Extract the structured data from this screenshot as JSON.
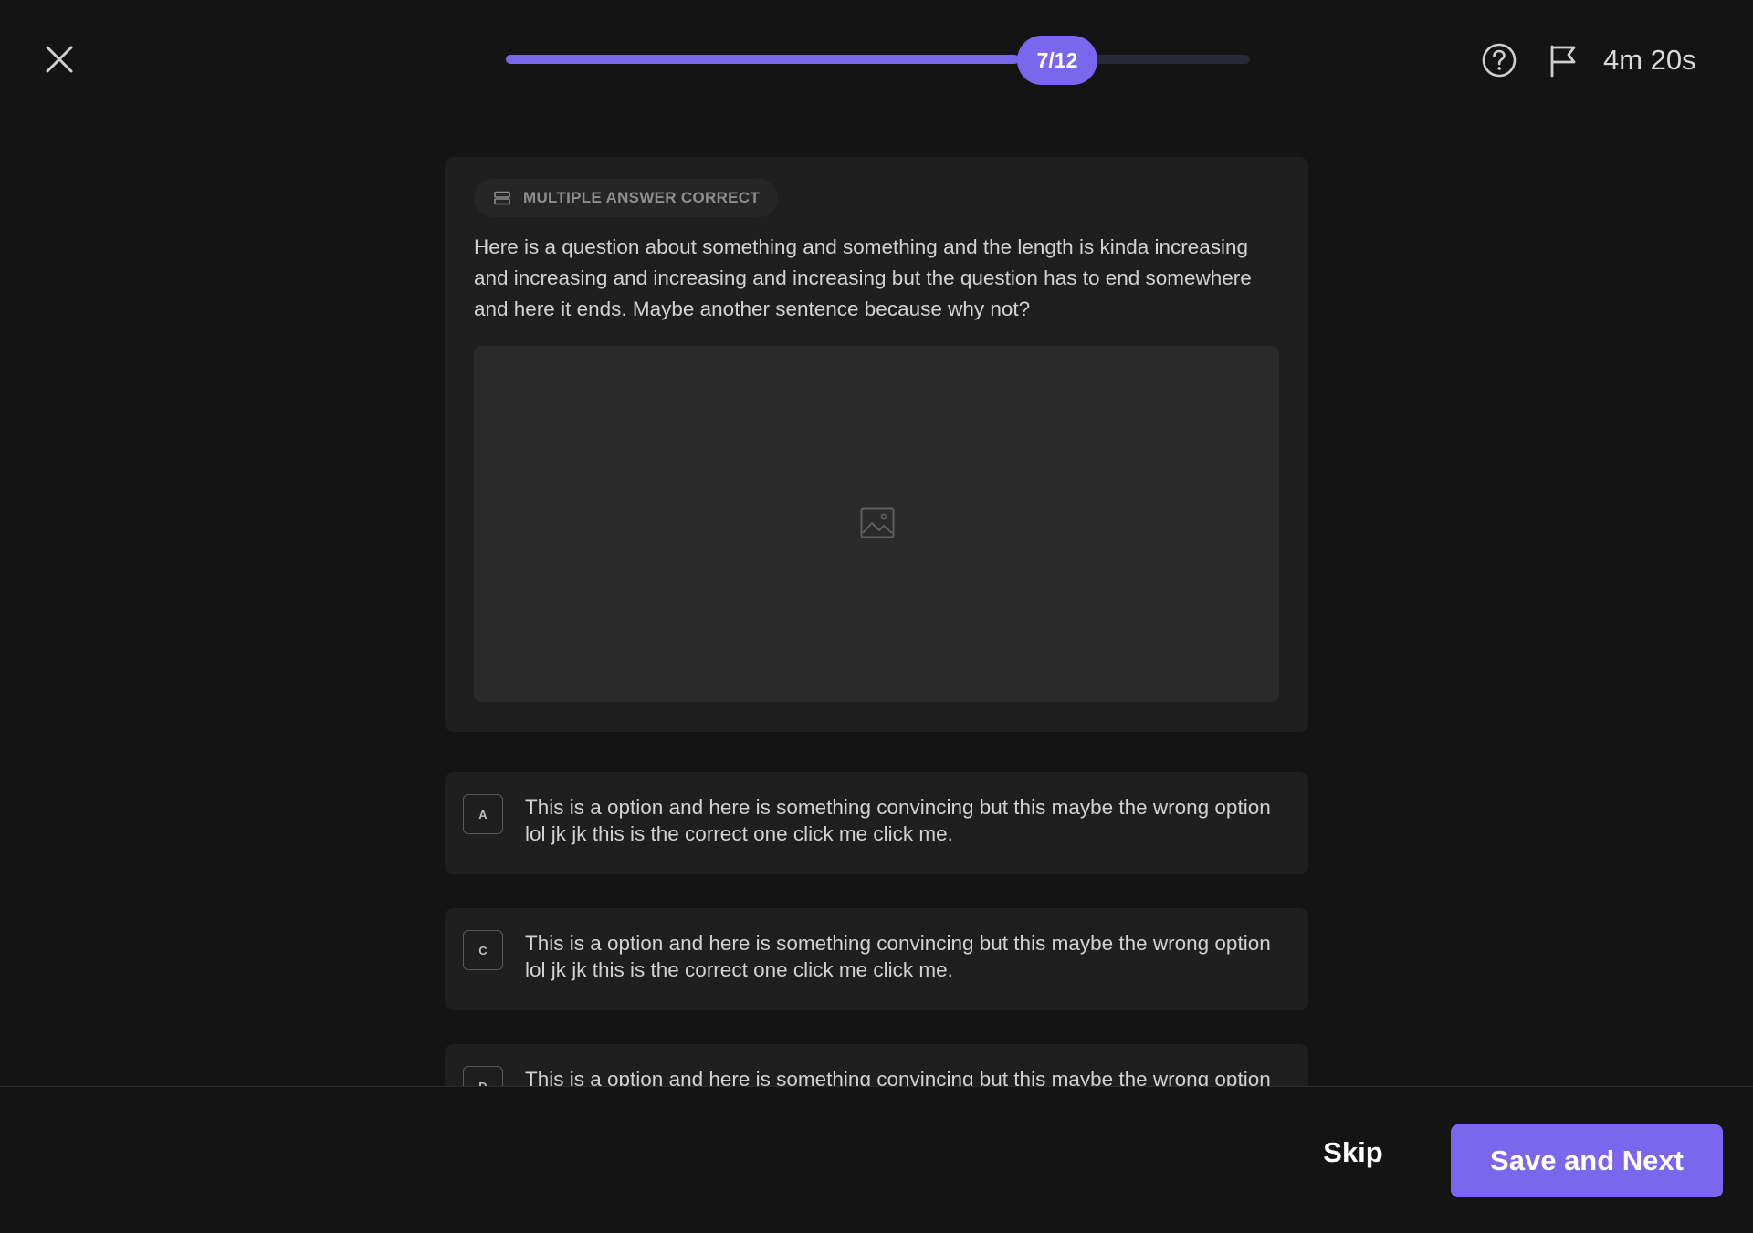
{
  "header": {
    "progress": {
      "label": "7/12",
      "current": 7,
      "total": 12,
      "fill_fraction": 0.69
    },
    "timer": "4m 20s"
  },
  "question": {
    "type_label": "MULTIPLE ANSWER CORRECT",
    "text": "Here is a question about something and something and the length is kinda increasing and increasing and increasing and increasing but the question has to end somewhere and here it ends. Maybe another sentence because why not?"
  },
  "options": [
    {
      "key": "A",
      "text": "This is a option and here is something convincing but this maybe the wrong option lol jk jk this is the correct one click me click me."
    },
    {
      "key": "C",
      "text": "This is a option and here is something convincing but this maybe the wrong option lol jk jk this is the correct one click me click me."
    },
    {
      "key": "D",
      "text": "This is a option and here is something convincing but this maybe the wrong option lol jk jk this is the correct one click me click me."
    }
  ],
  "footer": {
    "skip_label": "Skip",
    "save_label": "Save and Next"
  },
  "colors": {
    "accent": "#7b67ee",
    "background": "#141414",
    "card": "#1f1f1f"
  }
}
